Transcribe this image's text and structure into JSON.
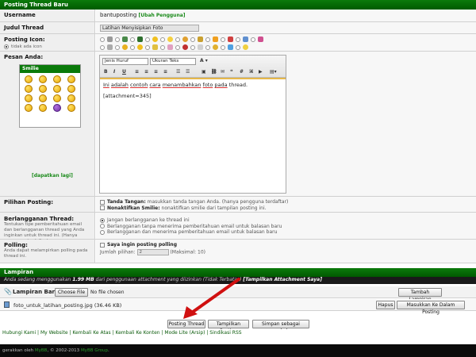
{
  "thread_header": "Posting Thread Baru",
  "username": {
    "label": "Username",
    "value": "bantuposting",
    "change_link": "[Ubah Pengguna]"
  },
  "subject": {
    "label": "Judul Thread",
    "value": "Latihan Menyisipkan Foto"
  },
  "post_icon": {
    "label": "Posting Icon:",
    "no_icon": "tidak ada icon"
  },
  "message": {
    "label": "Pesan Anda:",
    "smilies_title": "Smilie",
    "get_more": "[dapatkan lagi]",
    "font_select": "Jenis Huruf",
    "size_select": "Ukuran Teks",
    "text_line": "Ini adalah contoh cara menambahkan foto pada thread.",
    "text_words": [
      "Ini",
      "adalah",
      "contoh",
      "cara",
      "menambahkan",
      "foto",
      "pada",
      "thread."
    ],
    "attachment_code": "[attachment=345]"
  },
  "post_options": {
    "label": "Pilihan Posting:",
    "signature_title": "Tanda Tangan:",
    "signature_desc": "masukkan tanda tangan Anda. (hanya pengguna terdaftar)",
    "smilies_title": "Nonaktifkan Smilie:",
    "smilies_desc": "nonaktifkan smilie dari tampilan posting ini."
  },
  "subscribe": {
    "label": "Berlangganan Thread:",
    "desc": "Tentukan tipe pemberitahuan email dan berlangganan thread yang Anda inginkan untuk thread ini. (Hanya pengguna terdaftar)",
    "options": [
      "Jangan berlangganan ke thread ini",
      "Berlangganan tanpa menerima pemberitahuan email untuk balasan baru",
      "Berlangganan dan menerima pemberitahuan email untuk balasan baru"
    ]
  },
  "polling": {
    "label": "Polling:",
    "desc": "Anda dapat melampirkan polling pada thread ini.",
    "checkbox": "Saya ingin posting polling",
    "options_label": "Jumlah pilihan:",
    "options_value": "2",
    "max": "(Maksimal: 10)"
  },
  "attachments": {
    "header": "Lampiran",
    "quota_before": "Anda sedang menggunakan ",
    "quota_used": "1.99 MB",
    "quota_mid": " dari penggunaan attachment yang diizinkan (Tidak Terbatas)",
    "quota_link": "[Tampilkan Attachment Saya]",
    "new_label": "Lampiran Baru:",
    "choose_file": "Choose File",
    "no_file": "No file chosen",
    "add_button": "Tambah Lampiran",
    "file_name": "foto_untuk_latihan_posting.jpg (36.46 KB)",
    "delete_button": "Hapus",
    "insert_button": "Masukkan Ke Dalam Posting"
  },
  "actions": {
    "post": "Posting Thread",
    "preview": "Tampilkan Posting",
    "save": "Simpan sebagai naskah"
  },
  "footer_links": "Hubungi Kami | My Website | Kembali Ke Atas | Kembali Ke Konten | Mode Lite (Arsip) | Sindikasi RSS",
  "copyright": {
    "before": "gerakkan oleh ",
    "brand": "MyBB",
    "mid": ", © 2002-2013 ",
    "group": "MyBB Group",
    "end": "."
  },
  "colors": {
    "header_green": "#0a7a0a",
    "link_green": "#1a8a1a",
    "arrow_red": "#d01010"
  }
}
